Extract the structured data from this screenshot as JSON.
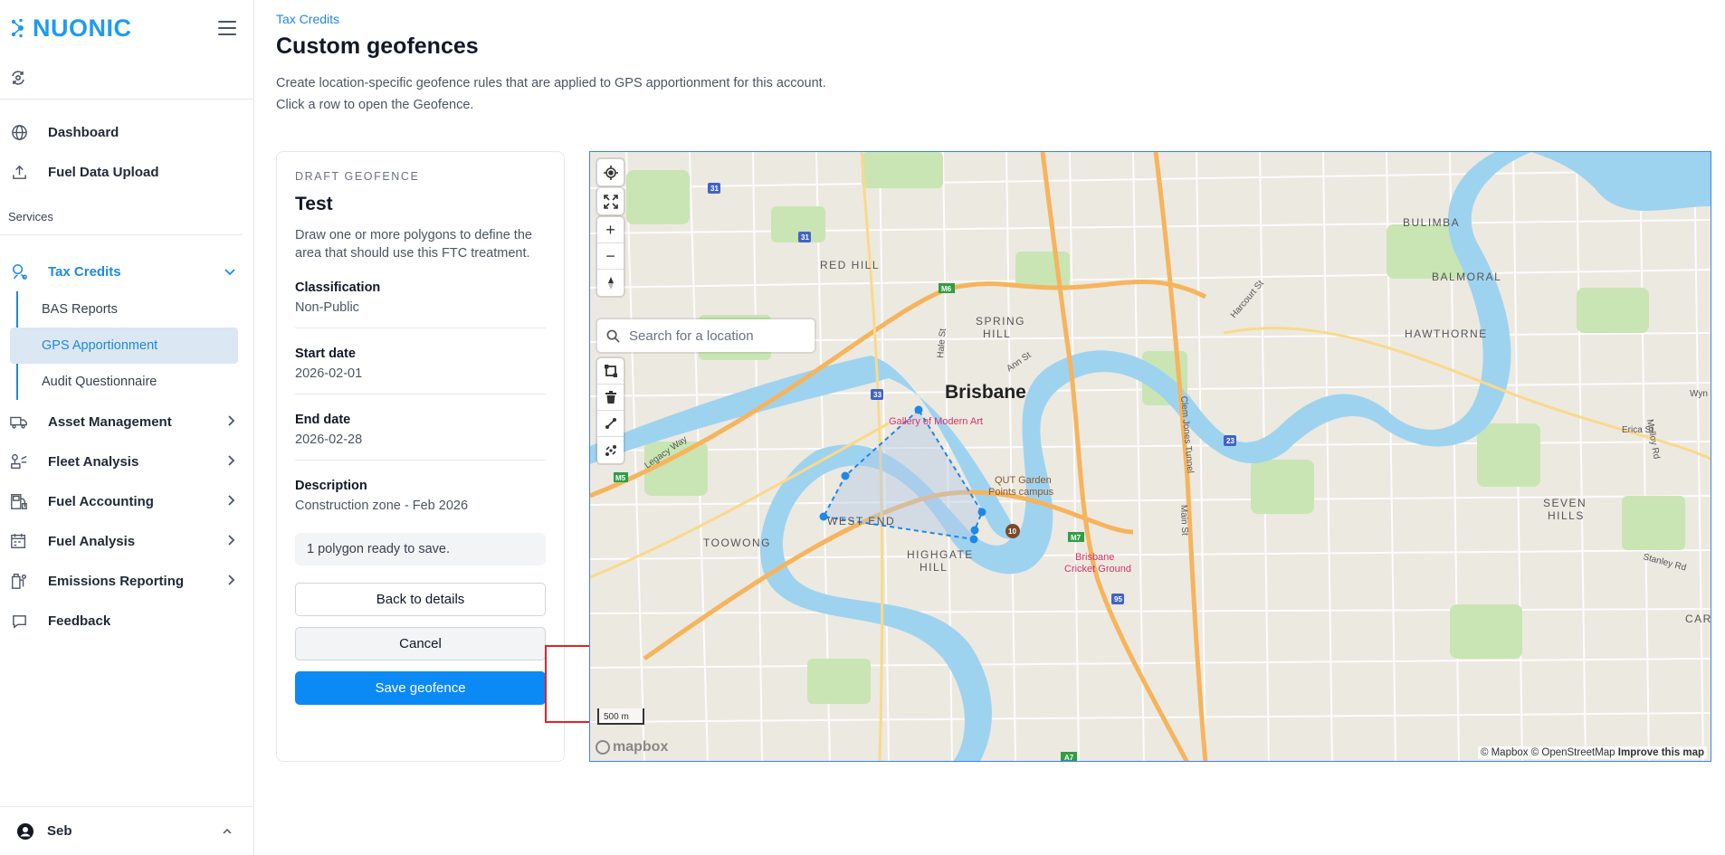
{
  "brand": {
    "name": "NUONIC",
    "color": "#1e9bf0"
  },
  "sidebar": {
    "top_items": [
      {
        "label": "Dashboard",
        "icon": "globe-icon"
      },
      {
        "label": "Fuel Data Upload",
        "icon": "upload-icon"
      }
    ],
    "section_label": "Services",
    "tax_credits": {
      "label": "Tax Credits",
      "icon": "tax-credits-icon",
      "expanded": true,
      "children": [
        "BAS Reports",
        "GPS Apportionment",
        "Audit Questionnaire"
      ],
      "selected": "GPS Apportionment"
    },
    "items": [
      {
        "label": "Asset Management",
        "icon": "truck-icon"
      },
      {
        "label": "Fleet Analysis",
        "icon": "fleet-analysis-icon"
      },
      {
        "label": "Fuel Accounting",
        "icon": "fuel-accounting-icon"
      },
      {
        "label": "Fuel Analysis",
        "icon": "fuel-analysis-icon"
      },
      {
        "label": "Emissions Reporting",
        "icon": "emissions-icon"
      },
      {
        "label": "Feedback",
        "icon": "chat-bubble-icon"
      }
    ],
    "user": {
      "name": "Seb"
    }
  },
  "page": {
    "breadcrumb": "Tax Credits",
    "title": "Custom geofences",
    "description_1": "Create location-specific geofence rules that are applied to GPS apportionment for this account.",
    "description_2": "Click a row to open the Geofence."
  },
  "draft": {
    "eyebrow": "DRAFT GEOFENCE",
    "name": "Test",
    "hint": "Draw one or more polygons to define the area that should use this FTC treatment.",
    "fields": [
      {
        "key": "Classification",
        "value": "Non-Public"
      },
      {
        "key": "Start date",
        "value": "2026-02-01"
      },
      {
        "key": "End date",
        "value": "2026-02-28"
      },
      {
        "key": "Description",
        "value": "Construction zone - Feb 2026"
      }
    ],
    "status": "1 polygon ready to save.",
    "back_label": "Back to details",
    "cancel_label": "Cancel",
    "save_label": "Save geofence"
  },
  "map": {
    "search_placeholder": "Search for a location",
    "labels": {
      "city": "Brisbane",
      "bulimba": "BULIMBA",
      "balmoral": "BALMORAL",
      "hawthorne": "HAWTHORNE",
      "red_hill": "RED HILL",
      "spring_hill_1": "SPRING",
      "spring_hill_2": "HILL",
      "toowong": "TOOWONG",
      "west_end": "WEST END",
      "highgate_1": "HIGHGATE",
      "highgate_2": "HILL",
      "seven_hills_1": "SEVEN",
      "seven_hills_2": "HILLS",
      "gallery": "Gallery of Modern Art",
      "qut_1": "QUT Garden",
      "qut_2": "Points campus",
      "cricket_1": "Brisbane",
      "cricket_2": "Cricket Ground",
      "hale_st": "Hale St",
      "ann_st": "Ann St",
      "clem_jones": "Clem Jones Tunnel",
      "main_st": "Main St",
      "harcourt_st": "Harcourt St",
      "legacy_way": "Legacy Way",
      "stanley_rd": "Stanley Rd",
      "erica_st": "Erica St",
      "molloy_rd": "Molloy Rd",
      "wyn": "Wyn",
      "cari": "CARI",
      "m5": "M5",
      "m6": "M6",
      "m7": "M7",
      "a7": "A7",
      "r31": "31",
      "r31b": "31",
      "r32": "32",
      "r33": "33",
      "r23": "23",
      "r95": "95",
      "r10": "10"
    },
    "scale_label": "500 m",
    "mapbox_label": "mapbox",
    "attribution": "© Mapbox © OpenStreetMap",
    "improve_label": "Improve this map",
    "colors": {
      "water": "#9ed3f0",
      "park": "#c9e5b3",
      "land": "#ece9e1",
      "motorway": "#f6b45c",
      "polygon_stroke": "#1e88e5"
    }
  }
}
